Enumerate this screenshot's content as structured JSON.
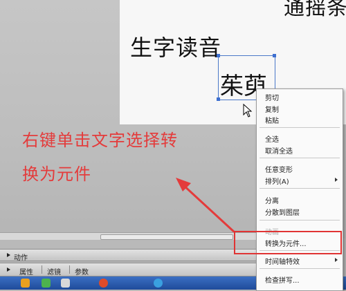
{
  "stage": {
    "title_partial": "通摇条",
    "text_line": "生字读音",
    "selected_text": "茱萸"
  },
  "annotation": {
    "line1": "右键单击文字选择转",
    "line2": "换为元件"
  },
  "context_menu": {
    "cut": "剪切",
    "copy": "复制",
    "paste": "粘贴",
    "select_all": "全选",
    "deselect_all": "取消全选",
    "free_transform": "任意变形",
    "arrange": "排列(A)",
    "break_apart": "分离",
    "distribute_to_layers": "分散到图层",
    "disabled_item": "动画",
    "convert_to_symbol": "转换为元件...",
    "timeline_effects": "时间轴特效",
    "check_spelling": "检查拼写..."
  },
  "panels": {
    "actions": "动作",
    "properties": "属性",
    "filters": "滤镜",
    "parameters": "参数"
  },
  "colors": {
    "annotation": "#e43b3b",
    "highlight": "#e03333",
    "selection": "#4a78c8",
    "taskbar": "#2a5aae"
  }
}
